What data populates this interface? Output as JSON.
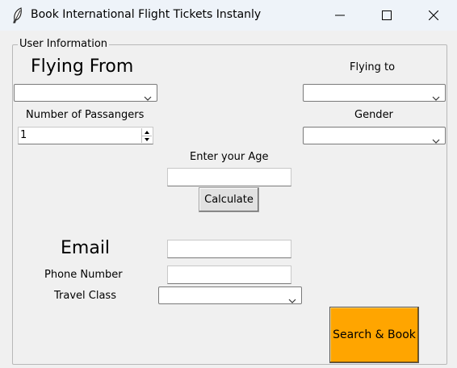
{
  "window": {
    "title": "Book International Flight Tickets Instanly"
  },
  "frame": {
    "label": "User Information"
  },
  "form": {
    "flying_from_label": "Flying From",
    "flying_from_value": "",
    "flying_to_label": "Flying to",
    "flying_to_value": "",
    "passengers_label": "Number of Passangers",
    "passengers_value": "1",
    "gender_label": "Gender",
    "gender_value": "",
    "age_label": "Enter your Age",
    "age_value": "",
    "calculate_label": "Calculate",
    "email_label": "Email",
    "email_value": "",
    "phone_label": "Phone Number",
    "phone_value": "",
    "travel_class_label": "Travel Class",
    "travel_class_value": "",
    "search_label": "Search & Book"
  },
  "colors": {
    "search_button": "#ffa500",
    "titlebar": "#eef3f9",
    "background": "#f0f0f0"
  },
  "icons": {
    "app": "feather-icon",
    "minimize": "minimize-icon",
    "maximize": "maximize-icon",
    "close": "close-icon",
    "dropdown": "chevron-down-icon"
  }
}
